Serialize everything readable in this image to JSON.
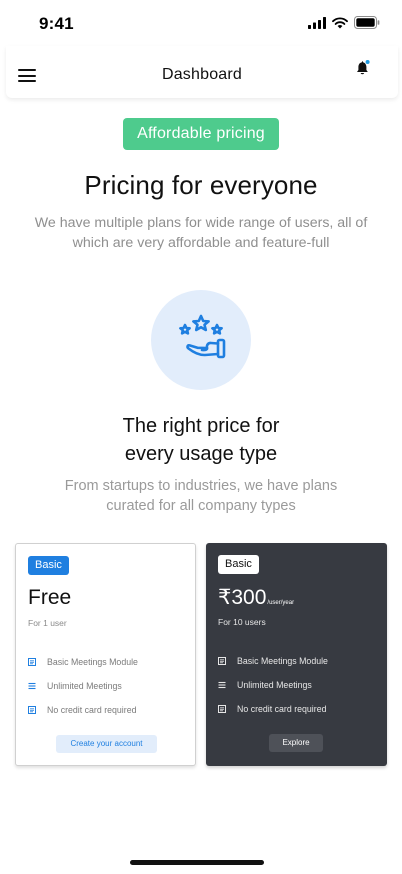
{
  "status_bar": {
    "time": "9:41"
  },
  "header": {
    "title": "Dashboard"
  },
  "hero": {
    "badge": "Affordable pricing",
    "title": "Pricing for everyone",
    "subtitle": "We have multiple plans for wide range of users, all of which are very affordable and feature-full"
  },
  "section": {
    "title_line1": "The right price for",
    "title_line2": "every usage type",
    "subtitle": "From startups to industries, we have plans curated for all company types"
  },
  "plans": [
    {
      "badge": "Basic",
      "price": "Free",
      "unit": "",
      "users": "For 1 user",
      "features": [
        "Basic Meetings Module",
        "Unlimited Meetings",
        "No credit card required"
      ],
      "button": "Create your account"
    },
    {
      "badge": "Basic",
      "price": "₹300",
      "unit": "/user/year",
      "users": "For 10 users",
      "features": [
        "Basic Meetings Module",
        "Unlimited Meetings",
        "No credit card required"
      ],
      "button": "Explore"
    }
  ],
  "colors": {
    "accent_green": "#4ecb8d",
    "accent_blue": "#1f7fe0",
    "dark_card": "#373a41",
    "icon_bg": "#e2edfb"
  },
  "icons": {
    "menu": "hamburger-icon",
    "notifications": "bell-icon",
    "hero": "hand-stars-icon",
    "feature_doc": "document-icon",
    "feature_list": "list-icon"
  }
}
